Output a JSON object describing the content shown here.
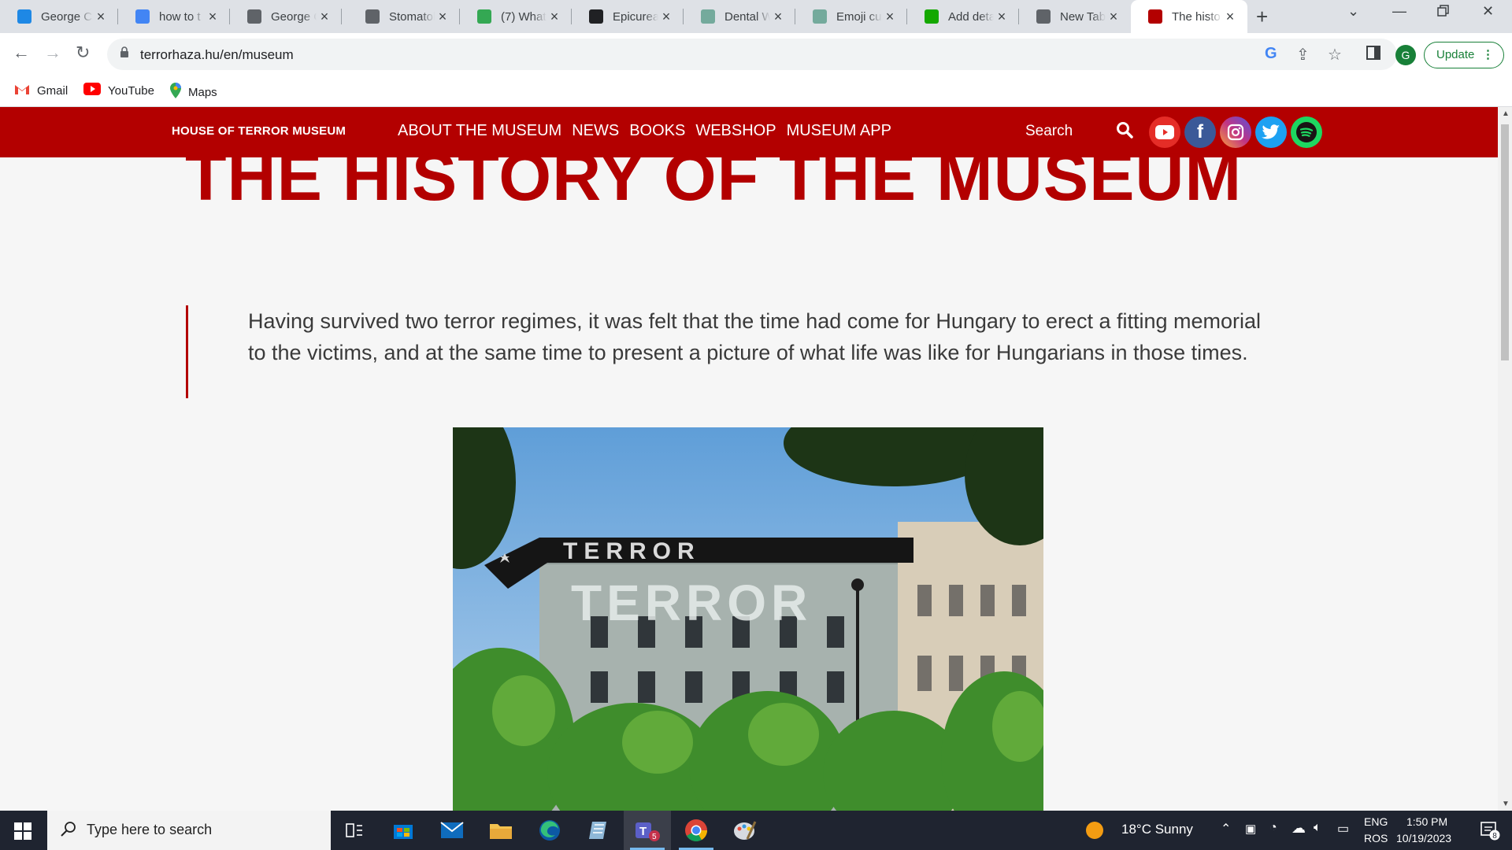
{
  "browser": {
    "tabs": [
      {
        "title": "George C",
        "icon": "vee-icon",
        "color": "#1e88e5",
        "active": false
      },
      {
        "title": "how to t",
        "icon": "google-icon",
        "color": "#4285f4",
        "active": false
      },
      {
        "title": "George C",
        "icon": "gc-icon",
        "color": "#5f6368",
        "active": false
      },
      {
        "title": "Stomatol",
        "icon": "triangle-icon",
        "color": "#5f6368",
        "active": false
      },
      {
        "title": "(7) What",
        "icon": "quora-icon",
        "color": "#34a853",
        "active": false
      },
      {
        "title": "Epicurea",
        "icon": "olx-icon",
        "color": "#202124",
        "active": false
      },
      {
        "title": "Dental W",
        "icon": "chatgpt-icon",
        "color": "#74aa9c",
        "active": false
      },
      {
        "title": "Emoji cu",
        "icon": "chatgpt-icon",
        "color": "#74aa9c",
        "active": false
      },
      {
        "title": "Add deta",
        "icon": "upwork-icon",
        "color": "#14a800",
        "active": false
      },
      {
        "title": "New Tab",
        "icon": "chrome-icon",
        "color": "#5f6368",
        "active": false
      },
      {
        "title": "The histo",
        "icon": "museum-icon",
        "color": "#b30000",
        "active": true
      }
    ],
    "url": "terrorhaza.hu/en/museum",
    "update_label": "Update",
    "profile_initial": "G",
    "bookmarks": [
      {
        "label": "Gmail",
        "icon": "gmail-icon"
      },
      {
        "label": "YouTube",
        "icon": "youtube-icon"
      },
      {
        "label": "Maps",
        "icon": "maps-icon"
      }
    ]
  },
  "site": {
    "brand": "HOUSE OF TERROR MUSEUM",
    "menu": [
      "ABOUT THE MUSEUM",
      "NEWS",
      "BOOKS",
      "WEBSHOP",
      "MUSEUM APP"
    ],
    "search_label": "Search",
    "social": [
      {
        "name": "youtube",
        "color": "#e52d27"
      },
      {
        "name": "facebook",
        "color": "#3b5998"
      },
      {
        "name": "instagram",
        "color": "#c13584"
      },
      {
        "name": "twitter",
        "color": "#1da1f2"
      },
      {
        "name": "spotify",
        "color": "#1ed760"
      }
    ],
    "accent_color": "#b30000",
    "page_title": "THE HISTORY OF THE MUSEUM",
    "intro": "Having survived two terror regimes, it was felt that the time had come for Hungary to erect a fitting memorial to the victims, and at the same time to present a picture of what life was like for Hungarians in those times.",
    "photo_sign_text": "TERROR",
    "photo_banner_text": "TERROR"
  },
  "taskbar": {
    "search_placeholder": "Type here to search",
    "weather": "18°C  Sunny",
    "lang_top": "ENG",
    "lang_bottom": "ROS",
    "time": "1:50 PM",
    "date": "10/19/2023",
    "notifications": "8",
    "teams_badge": "5"
  }
}
